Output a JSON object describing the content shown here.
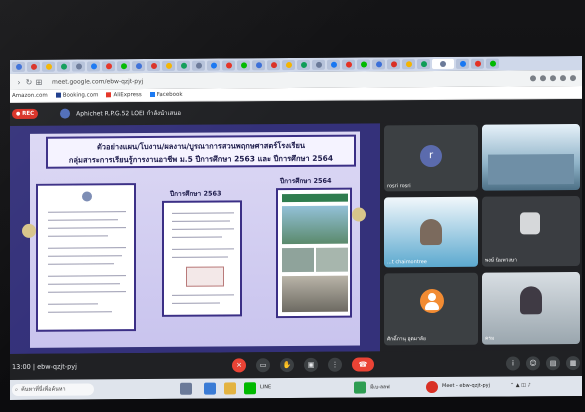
{
  "browser": {
    "tabs_count": 32,
    "url": "meet.google.com/ebw-qzjt-pyj",
    "bookmarks": [
      "Amazon.com",
      "Booking.com",
      "AliExpress",
      "Facebook"
    ]
  },
  "meeting": {
    "rec_label": "REC",
    "presenter": "Aphichet R.P.G.52 LOEI กำลังนำเสนอ",
    "meeting_code": "ebw-qzjt-pyj",
    "time": "13:00",
    "time_sep": "|"
  },
  "slide": {
    "title_line1": "ตัวอย่างแผน/โบงาน/ผลงาน/บูรณาการสวนพฤกษศาสตร์โรงเรียน",
    "title_line2": "กลุ่มสาระการเรียนรู้การงานอาชีพ ม.5 ปีการศึกษา 2563 และ ปีการศึกษา 2564",
    "label_2563": "ปีการศึกษา 2563",
    "label_2564": "ปีการศึกษา 2564"
  },
  "participants": [
    {
      "name": "rosri rosri",
      "initial": "r"
    },
    {
      "name": ""
    },
    {
      "name": "...t chaimontree"
    },
    {
      "name": "พงษ์ นิมพวงษา"
    },
    {
      "name": "ศักดิ์ภานุ อุตมาลัย"
    },
    {
      "name": "ครม"
    }
  ],
  "taskbar": {
    "search_placeholder": "ค้นหาที่นี่เพื่อค้นหา",
    "line_label": "LINE",
    "explorer_label": "มีเบ-ลลฟ",
    "chrome_label": "Meet - ebw-qzjt-pyj"
  },
  "colors": {
    "slide_bg": "#34317a",
    "slide_panel": "#c9c4ee",
    "hangup": "#ea4335",
    "rec": "#d93025"
  }
}
